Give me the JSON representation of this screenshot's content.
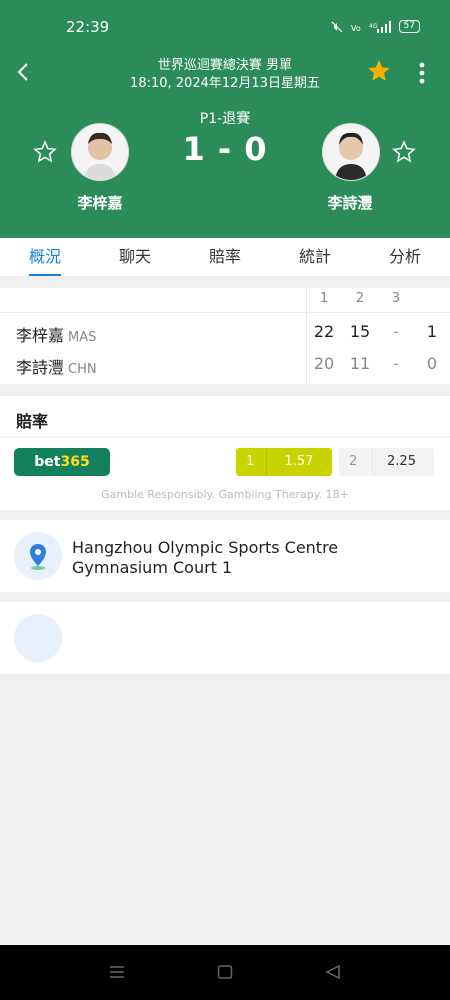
{
  "status": {
    "time": "22:39",
    "battery": "57"
  },
  "header": {
    "title_line1": "世界巡迴賽總決賽 男單",
    "title_line2": "18:10, 2024年12月13日星期五",
    "round": "P1-退賽",
    "score": "1 - 0",
    "player1": "李梓嘉",
    "player2": "李詩灃",
    "accent": "#2b8c5a",
    "favorite_color": "#f5b000"
  },
  "tabs": [
    "概況",
    "聊天",
    "賠率",
    "統計",
    "分析"
  ],
  "scoreboard": {
    "columns": [
      "1",
      "2",
      "3"
    ],
    "rows": [
      {
        "name": "李梓嘉",
        "country": "MAS",
        "g1": "22",
        "g2": "15",
        "g3": "-",
        "total": "1"
      },
      {
        "name": "李詩灃",
        "country": "CHN",
        "g1": "20",
        "g2": "11",
        "g3": "-",
        "total": "0"
      }
    ]
  },
  "odds": {
    "title": "賠率",
    "bookmaker_a": "bet",
    "bookmaker_b": "365",
    "home_label": "1",
    "home_odd": "1.57",
    "away_label": "2",
    "away_odd": "2.25",
    "disclaimer": "Gamble Responsibly. Gambling Therapy. 18+"
  },
  "venue": {
    "text": "Hangzhou Olympic Sports Centre Gymnasium Court 1",
    "icon": "location-pin-icon"
  }
}
